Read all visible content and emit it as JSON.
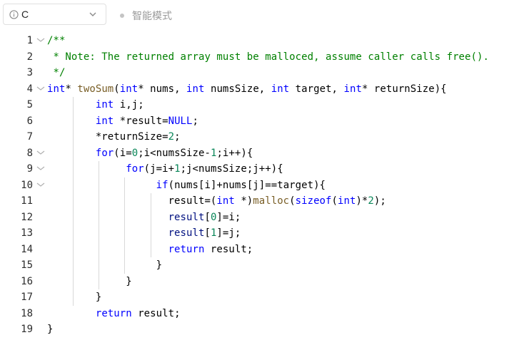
{
  "toolbar": {
    "language": "C",
    "mode_label": "智能模式",
    "icons": {
      "info": "info-circle-icon",
      "chevron": "chevron-down-icon"
    }
  },
  "colors": {
    "keyword": "#0000ff",
    "comment": "#008000",
    "function": "#795e26",
    "number": "#098658",
    "identifier": "#001080"
  },
  "editor": {
    "lines": [
      {
        "n": "1",
        "fold": true,
        "tokens": [
          {
            "t": "/**",
            "c": "cm"
          }
        ]
      },
      {
        "n": "2",
        "fold": false,
        "tokens": [
          {
            "t": " * Note: The returned array must be malloced, assume caller calls free().",
            "c": "cm"
          }
        ]
      },
      {
        "n": "3",
        "fold": false,
        "tokens": [
          {
            "t": " */",
            "c": "cm"
          }
        ]
      },
      {
        "n": "4",
        "fold": true,
        "tokens": [
          {
            "t": "int",
            "c": "kw"
          },
          {
            "t": "* ",
            "c": ""
          },
          {
            "t": "twoSum",
            "c": "fn"
          },
          {
            "t": "(",
            "c": ""
          },
          {
            "t": "int",
            "c": "kw"
          },
          {
            "t": "* nums, ",
            "c": ""
          },
          {
            "t": "int",
            "c": "kw"
          },
          {
            "t": " numsSize, ",
            "c": ""
          },
          {
            "t": "int",
            "c": "kw"
          },
          {
            "t": " target, ",
            "c": ""
          },
          {
            "t": "int",
            "c": "kw"
          },
          {
            "t": "* returnSize){",
            "c": ""
          }
        ]
      },
      {
        "n": "5",
        "fold": false,
        "tokens": [
          {
            "t": "        ",
            "c": ""
          },
          {
            "t": "int",
            "c": "kw"
          },
          {
            "t": " i,j;",
            "c": ""
          }
        ]
      },
      {
        "n": "6",
        "fold": false,
        "tokens": [
          {
            "t": "        ",
            "c": ""
          },
          {
            "t": "int",
            "c": "kw"
          },
          {
            "t": " *result=",
            "c": ""
          },
          {
            "t": "NULL",
            "c": "kw"
          },
          {
            "t": ";",
            "c": ""
          }
        ]
      },
      {
        "n": "7",
        "fold": false,
        "tokens": [
          {
            "t": "        *returnSize=",
            "c": ""
          },
          {
            "t": "2",
            "c": "num"
          },
          {
            "t": ";",
            "c": ""
          }
        ]
      },
      {
        "n": "8",
        "fold": true,
        "tokens": [
          {
            "t": "        ",
            "c": ""
          },
          {
            "t": "for",
            "c": "kw"
          },
          {
            "t": "(i=",
            "c": ""
          },
          {
            "t": "0",
            "c": "num"
          },
          {
            "t": ";i<numsSize-",
            "c": ""
          },
          {
            "t": "1",
            "c": "num"
          },
          {
            "t": ";i++){",
            "c": ""
          }
        ]
      },
      {
        "n": "9",
        "fold": true,
        "tokens": [
          {
            "t": "             ",
            "c": ""
          },
          {
            "t": "for",
            "c": "kw"
          },
          {
            "t": "(j=i+",
            "c": ""
          },
          {
            "t": "1",
            "c": "num"
          },
          {
            "t": ";j<numsSize;j++){",
            "c": ""
          }
        ]
      },
      {
        "n": "10",
        "fold": true,
        "tokens": [
          {
            "t": "                  ",
            "c": ""
          },
          {
            "t": "if",
            "c": "kw"
          },
          {
            "t": "(nums[i]+nums[j]==target){",
            "c": ""
          }
        ]
      },
      {
        "n": "11",
        "fold": false,
        "tokens": [
          {
            "t": "                    result=(",
            "c": ""
          },
          {
            "t": "int",
            "c": "kw"
          },
          {
            "t": " *)",
            "c": ""
          },
          {
            "t": "malloc",
            "c": "fn"
          },
          {
            "t": "(",
            "c": ""
          },
          {
            "t": "sizeof",
            "c": "kw"
          },
          {
            "t": "(",
            "c": ""
          },
          {
            "t": "int",
            "c": "kw"
          },
          {
            "t": ")*",
            "c": ""
          },
          {
            "t": "2",
            "c": "num"
          },
          {
            "t": ");",
            "c": ""
          }
        ]
      },
      {
        "n": "12",
        "fold": false,
        "tokens": [
          {
            "t": "                    ",
            "c": ""
          },
          {
            "t": "result",
            "c": "id"
          },
          {
            "t": "[",
            "c": ""
          },
          {
            "t": "0",
            "c": "num"
          },
          {
            "t": "]=i;",
            "c": ""
          }
        ]
      },
      {
        "n": "13",
        "fold": false,
        "tokens": [
          {
            "t": "                    ",
            "c": ""
          },
          {
            "t": "result",
            "c": "id"
          },
          {
            "t": "[",
            "c": ""
          },
          {
            "t": "1",
            "c": "num"
          },
          {
            "t": "]=j;",
            "c": ""
          }
        ]
      },
      {
        "n": "14",
        "fold": false,
        "tokens": [
          {
            "t": "                    ",
            "c": ""
          },
          {
            "t": "return",
            "c": "kw"
          },
          {
            "t": " result;",
            "c": ""
          }
        ]
      },
      {
        "n": "15",
        "fold": false,
        "tokens": [
          {
            "t": "                  }",
            "c": ""
          }
        ]
      },
      {
        "n": "16",
        "fold": false,
        "tokens": [
          {
            "t": "             }",
            "c": ""
          }
        ]
      },
      {
        "n": "17",
        "fold": false,
        "tokens": [
          {
            "t": "        }",
            "c": ""
          }
        ]
      },
      {
        "n": "18",
        "fold": false,
        "tokens": [
          {
            "t": "        ",
            "c": ""
          },
          {
            "t": "return",
            "c": "kw"
          },
          {
            "t": " result;",
            "c": ""
          }
        ]
      },
      {
        "n": "19",
        "fold": false,
        "tokens": [
          {
            "t": "}",
            "c": ""
          }
        ]
      }
    ]
  }
}
